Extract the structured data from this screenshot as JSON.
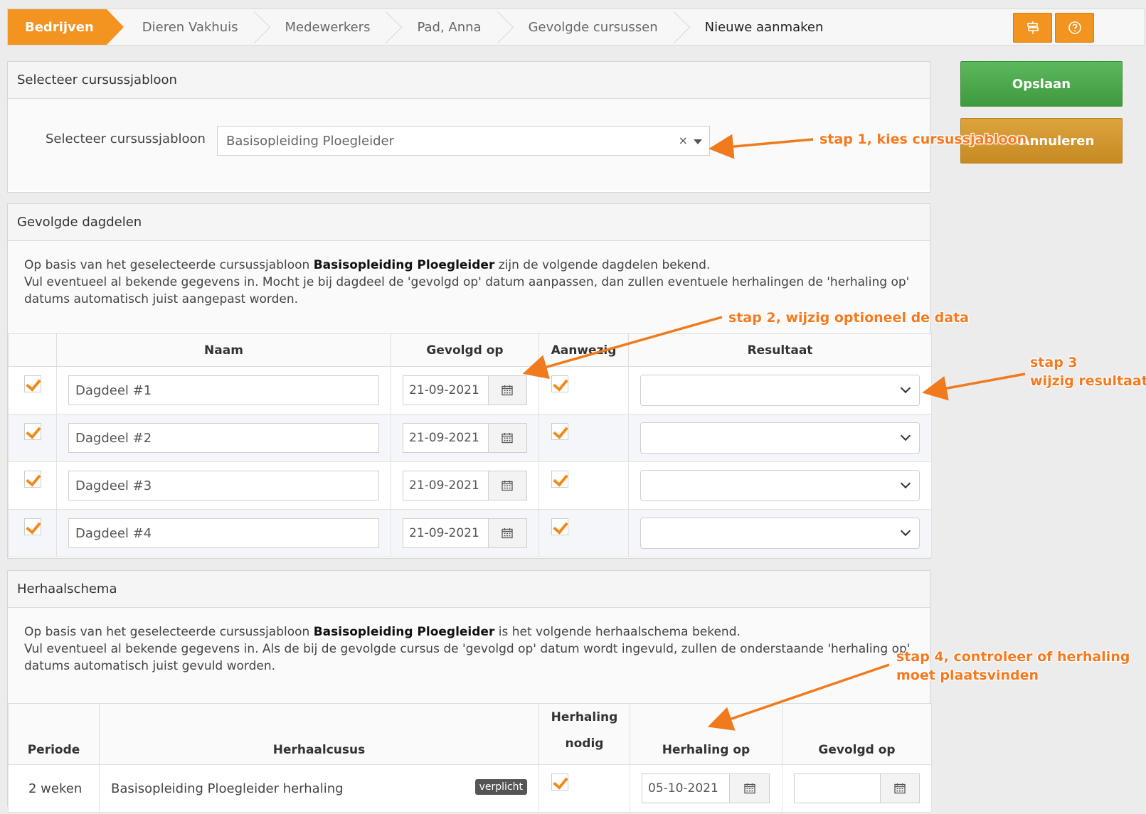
{
  "breadcrumb": {
    "items": [
      "Bedrijven",
      "Dieren Vakhuis",
      "Medewerkers",
      "Pad, Anna",
      "Gevolgde cursussen",
      "Nieuwe aanmaken"
    ]
  },
  "actions": {
    "save_label": "Opslaan",
    "cancel_label": "Annuleren"
  },
  "template_panel": {
    "title": "Selecteer cursussjabloon",
    "field_label": "Selecteer cursussjabloon",
    "selected_value": "Basisopleiding Ploegleider",
    "clear_symbol": "×"
  },
  "sessions_panel": {
    "title": "Gevolgde dagdelen",
    "intro_prefix": "Op basis van het geselecteerde cursussjabloon ",
    "intro_template": "Basisopleiding Ploegleider",
    "intro_suffix": " zijn de volgende dagdelen bekend.",
    "intro_line2": "Vul eventueel al bekende gegevens in. Mocht je bij dagdeel de 'gevolgd op' datum aanpassen, dan zullen eventuele herhalingen de 'herhaling op' datums automatisch juist aangepast worden.",
    "columns": [
      "Naam",
      "Gevolgd op",
      "Aanwezig",
      "Resultaat"
    ],
    "rows": [
      {
        "name": "Dagdeel #1",
        "date": "21-09-2021"
      },
      {
        "name": "Dagdeel #2",
        "date": "21-09-2021"
      },
      {
        "name": "Dagdeel #3",
        "date": "21-09-2021"
      },
      {
        "name": "Dagdeel #4",
        "date": "21-09-2021"
      }
    ]
  },
  "repeat_panel": {
    "title": "Herhaalschema",
    "intro_prefix": "Op basis van het geselecteerde cursussjabloon ",
    "intro_template": "Basisopleiding Ploegleider",
    "intro_suffix": " is het volgende herhaalschema bekend.",
    "intro_line2": "Vul eventueel al bekende gegevens in. Als de bij de gevolgde cursus de 'gevolgd op' datum wordt ingevuld, zullen de onderstaande 'herhaling op' datums automatisch juist gevuld worden.",
    "columns": {
      "period": "Periode",
      "course": "Herhaalcusus",
      "needed_line1": "Herhaling",
      "needed_line2": "nodig",
      "repeat_on": "Herhaling op",
      "followed_on": "Gevolgd op"
    },
    "row": {
      "period": "2 weken",
      "course": "Basisopleiding Ploegleider herhaling",
      "badge": "verplicht",
      "repeat_date": "05-10-2021",
      "followed_date": ""
    }
  },
  "annotations": {
    "step1": "stap 1, kies cursussjabloon",
    "step2": "stap 2, wijzig optioneel de data",
    "step3_line1": "stap 3",
    "step3_line2": "wijzig resultaat",
    "step4_line1": "stap 4, controleer of herhaling",
    "step4_line2": "moet plaatsvinden"
  },
  "colors": {
    "accent": "#f39320",
    "save": "#4cae4c",
    "cancel": "#d4982f",
    "annotation": "#f57a1f"
  }
}
